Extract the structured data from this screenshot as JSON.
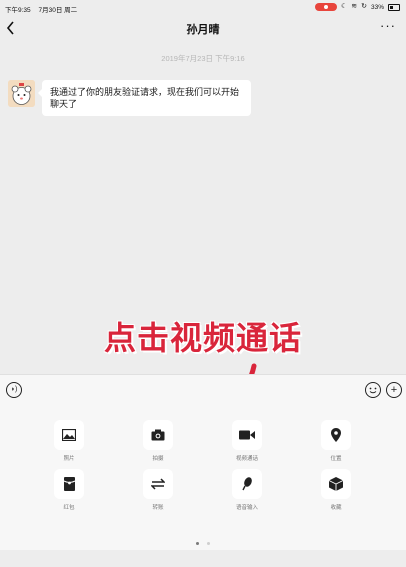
{
  "status_bar": {
    "time": "下午9:35",
    "date": "7月30日 周二",
    "battery": "33%",
    "record_color": "#e8453c"
  },
  "header": {
    "title": "孙月晴"
  },
  "chat": {
    "timestamp": "2019年7月23日 下午9:16",
    "messages": [
      {
        "sender": "孙月晴",
        "text": "我通过了你的朋友验证请求，现在我们可以开始聊天了"
      }
    ]
  },
  "annotation": {
    "text": "点击视频通话",
    "color": "#d9253b"
  },
  "input_bar": {
    "voice_icon": "voice-icon",
    "emoji_icon": "emoji-icon",
    "plus_icon": "plus-icon"
  },
  "tools": [
    {
      "label": "照片",
      "icon": "photo-icon"
    },
    {
      "label": "拍摄",
      "icon": "camera-icon"
    },
    {
      "label": "视频通话",
      "icon": "video-call-icon"
    },
    {
      "label": "位置",
      "icon": "location-icon"
    },
    {
      "label": "红包",
      "icon": "red-packet-icon"
    },
    {
      "label": "转账",
      "icon": "transfer-icon"
    },
    {
      "label": "语音输入",
      "icon": "voice-input-icon"
    },
    {
      "label": "收藏",
      "icon": "favorites-icon"
    }
  ],
  "pager": {
    "page": 1,
    "total": 2
  }
}
